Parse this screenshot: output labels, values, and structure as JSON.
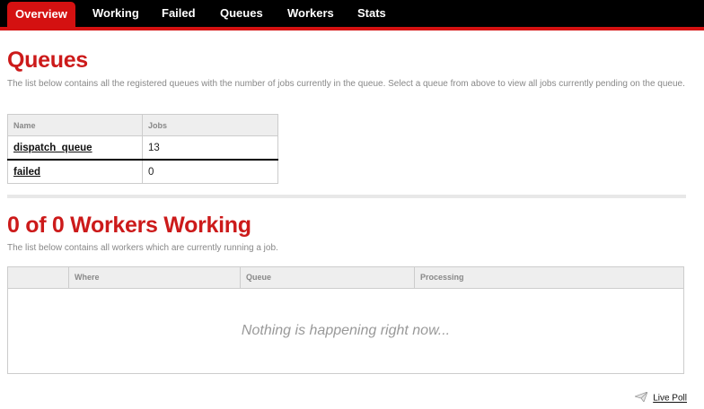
{
  "nav": {
    "tabs": [
      {
        "label": "Overview",
        "active": true
      },
      {
        "label": "Working",
        "active": false
      },
      {
        "label": "Failed",
        "active": false
      },
      {
        "label": "Queues",
        "active": false
      },
      {
        "label": "Workers",
        "active": false
      },
      {
        "label": "Stats",
        "active": false
      }
    ]
  },
  "queues": {
    "title": "Queues",
    "description": "The list below contains all the registered queues with the number of jobs currently in the queue. Select a queue from above to view all jobs currently pending on the queue.",
    "table": {
      "headers": [
        "Name",
        "Jobs"
      ],
      "rows": [
        {
          "name": "dispatch_queue",
          "jobs": "13"
        },
        {
          "name": "failed",
          "jobs": "0"
        }
      ]
    }
  },
  "workers": {
    "title": "0 of 0 Workers Working",
    "description": "The list below contains all workers which are currently running a job.",
    "table": {
      "headers": [
        "",
        "Where",
        "Queue",
        "Processing"
      ],
      "empty_message": "Nothing is happening right now..."
    }
  },
  "live_poll": {
    "label": "Live Poll",
    "icon": "paper-plane-icon"
  },
  "colors": {
    "accent": "#d41111",
    "heading": "#cc1a1a",
    "nav_bg": "#000000"
  }
}
